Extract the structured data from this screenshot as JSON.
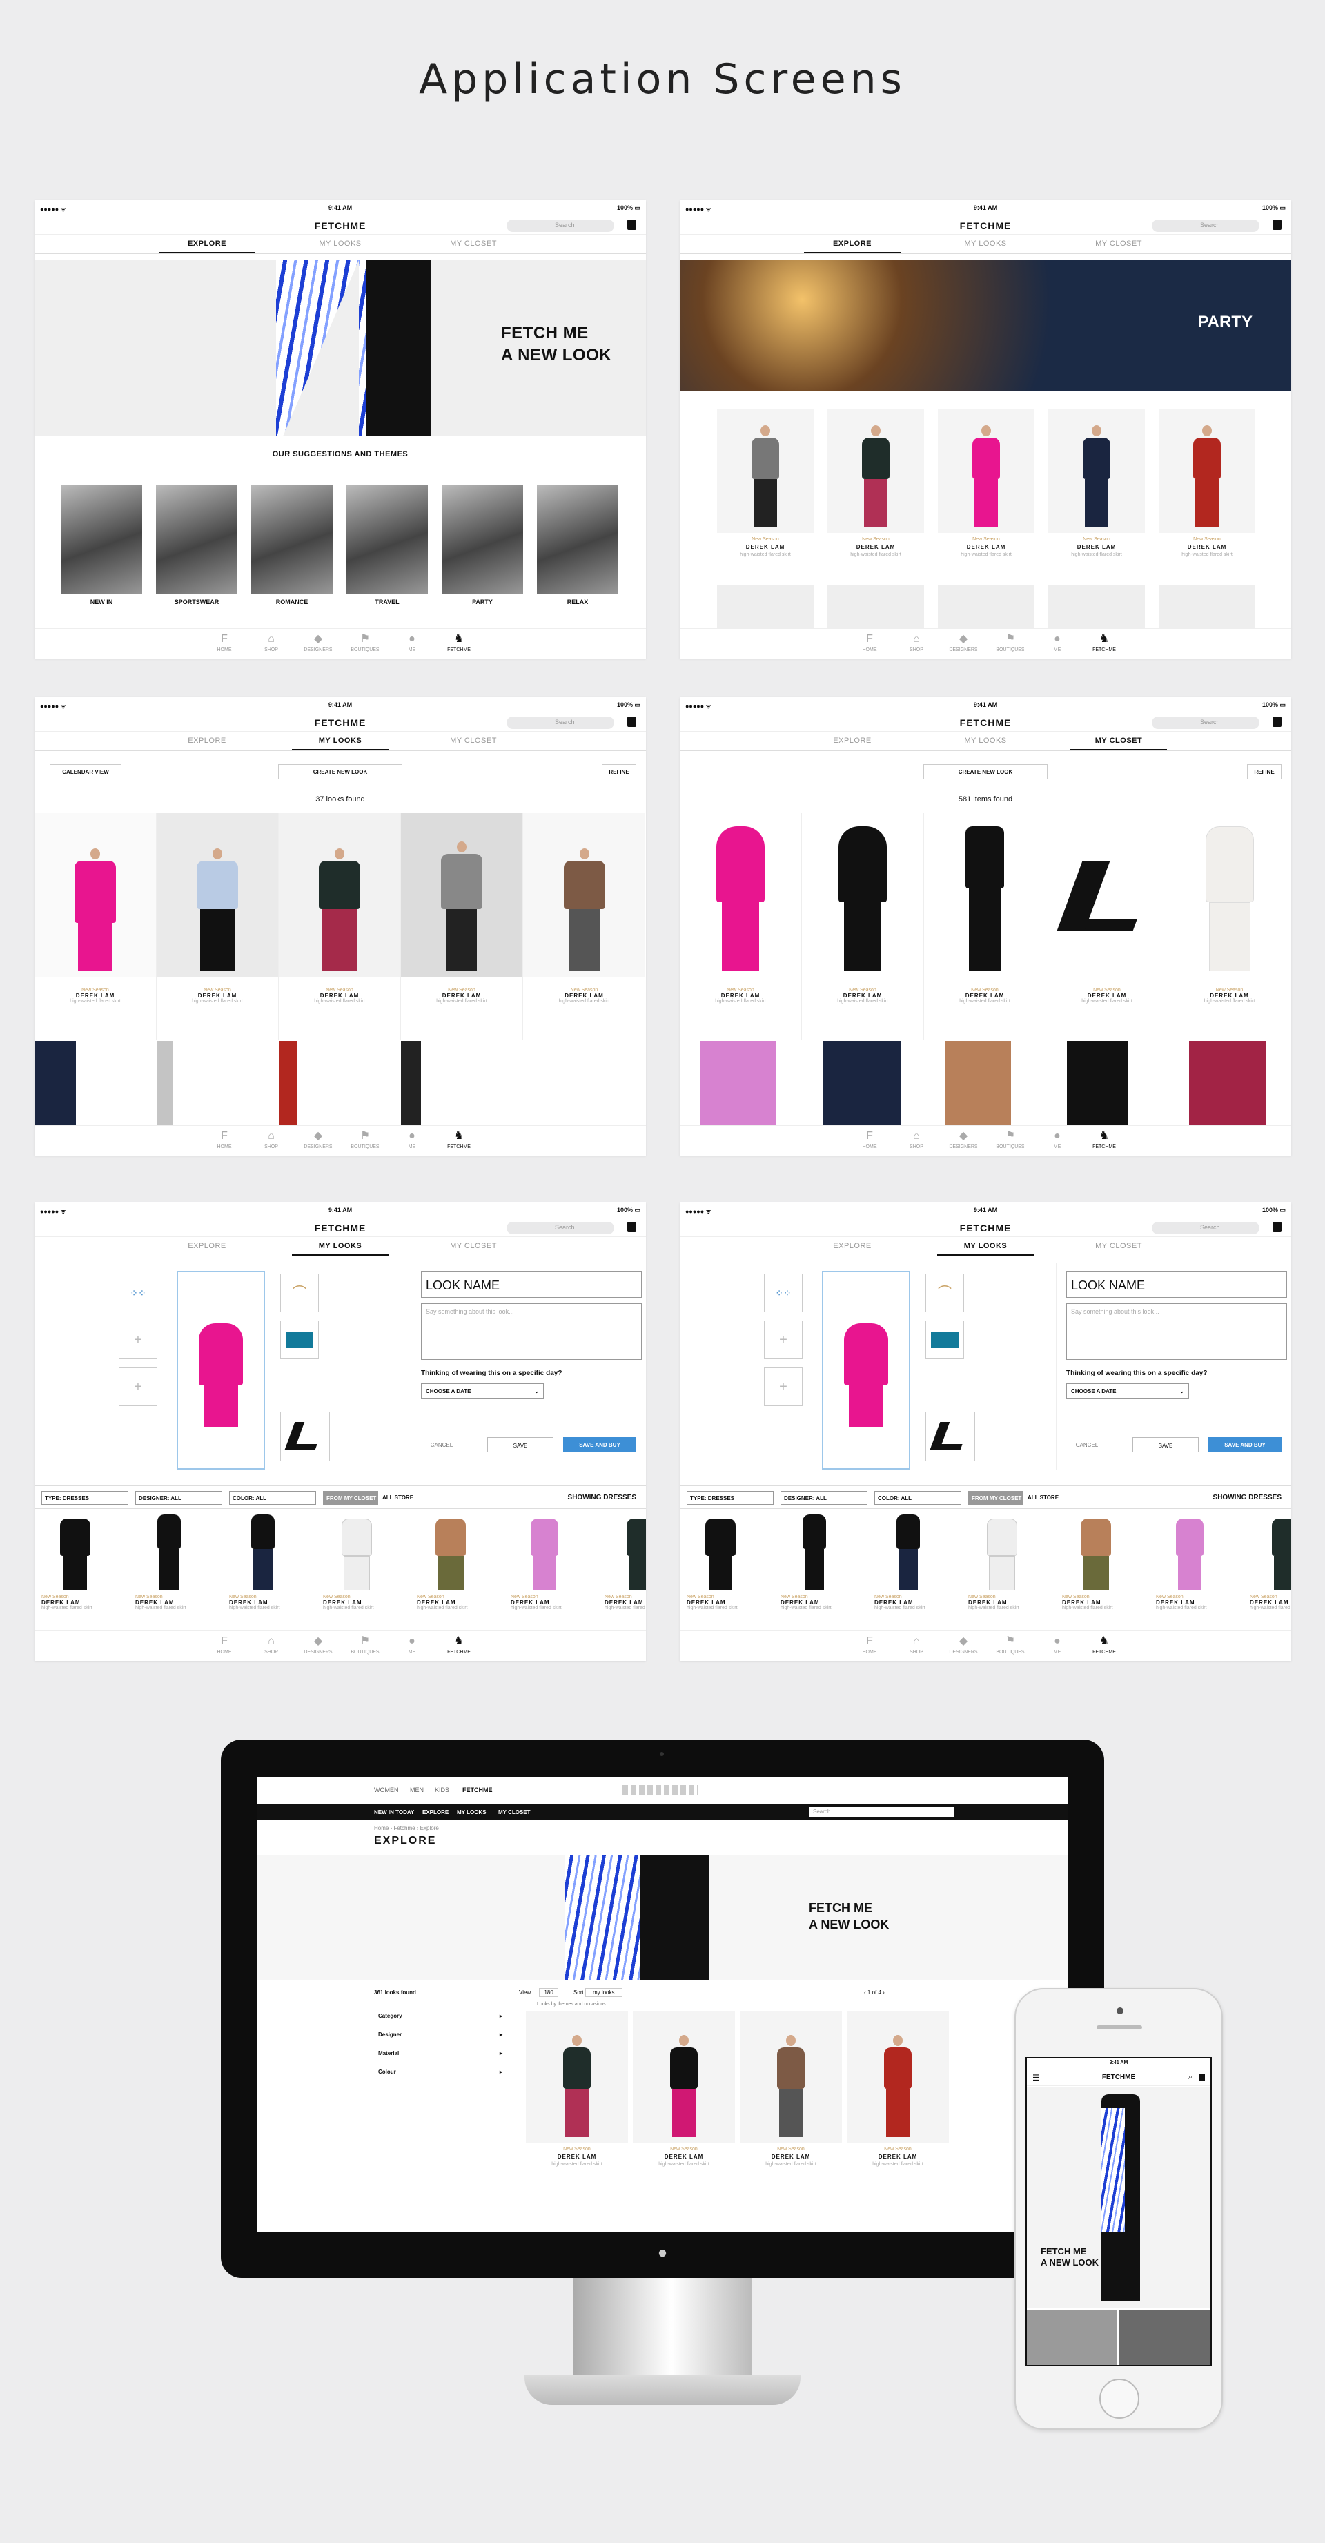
{
  "page": {
    "title": "Application Screens"
  },
  "app": {
    "status": {
      "signal": "●●●●● ᯤ",
      "time": "9:41 AM",
      "battery": "100% ▭"
    },
    "brand": "FETCHME",
    "search_placeholder": "Search",
    "tabs": [
      "EXPLORE",
      "MY LOOKS",
      "MY CLOSET"
    ],
    "nav": [
      "HOME",
      "SHOP",
      "DESIGNERS",
      "BOUTIQUES",
      "ME",
      "FETCHME"
    ]
  },
  "screen1": {
    "hero_line1": "FETCH ME",
    "hero_line2": "A NEW LOOK",
    "section_title": "OUR SUGGESTIONS AND THEMES",
    "themes": [
      "NEW IN",
      "SPORTSWEAR",
      "ROMANCE",
      "TRAVEL",
      "PARTY",
      "RELAX"
    ]
  },
  "screen2": {
    "hero": "PARTY"
  },
  "product": {
    "season": "New Season",
    "designer": "DEREK LAM",
    "desc": "high-waisted flared skirt"
  },
  "screen3": {
    "calendar": "CALENDAR VIEW",
    "create": "CREATE NEW LOOK",
    "refine": "REFINE",
    "count": "37 looks found"
  },
  "screen4": {
    "create": "CREATE NEW LOOK",
    "refine": "REFINE",
    "count": "581 items found"
  },
  "editor": {
    "look_name": "LOOK NAME",
    "desc_placeholder": "Say something about this look...",
    "question": "Thinking of wearing this on a specific day?",
    "choose_date": "CHOOSE A DATE",
    "cancel": "CANCEL",
    "save": "SAVE",
    "save_buy": "SAVE AND BUY",
    "filters": [
      "TYPE: DRESSES",
      "DESIGNER: ALL",
      "COLOR: ALL",
      "FROM MY CLOSET",
      "ALL STORE"
    ],
    "showing": "SHOWING DRESSES"
  },
  "desktop": {
    "topnav": [
      "WOMEN",
      "MEN",
      "KIDS",
      "FETCHME"
    ],
    "subnav": [
      "NEW IN TODAY",
      "EXPLORE",
      "MY LOOKS",
      "MY CLOSET"
    ],
    "search_placeholder": "Search",
    "breadcrumb": "Home › Fetchme › Explore",
    "title": "EXPLORE",
    "hero_line1": "FETCH ME",
    "hero_line2": "A NEW LOOK",
    "count": "361 looks found",
    "view_label": "View",
    "view_value": "180",
    "sort_label": "Sort",
    "sort_value": "my looks",
    "pages": "1 of 4",
    "looks_caption": "Looks by themes and occasions",
    "filters": [
      "Category",
      "Designer",
      "Material",
      "Colour"
    ]
  },
  "phone": {
    "time": "9:41 AM",
    "brand": "FETCHME",
    "hero_line1": "FETCH ME",
    "hero_line2": "A NEW LOOK"
  },
  "colors": {
    "accent_blue": "#3d8fd6",
    "magenta": "#e8158f",
    "gold": "#c9a265"
  }
}
